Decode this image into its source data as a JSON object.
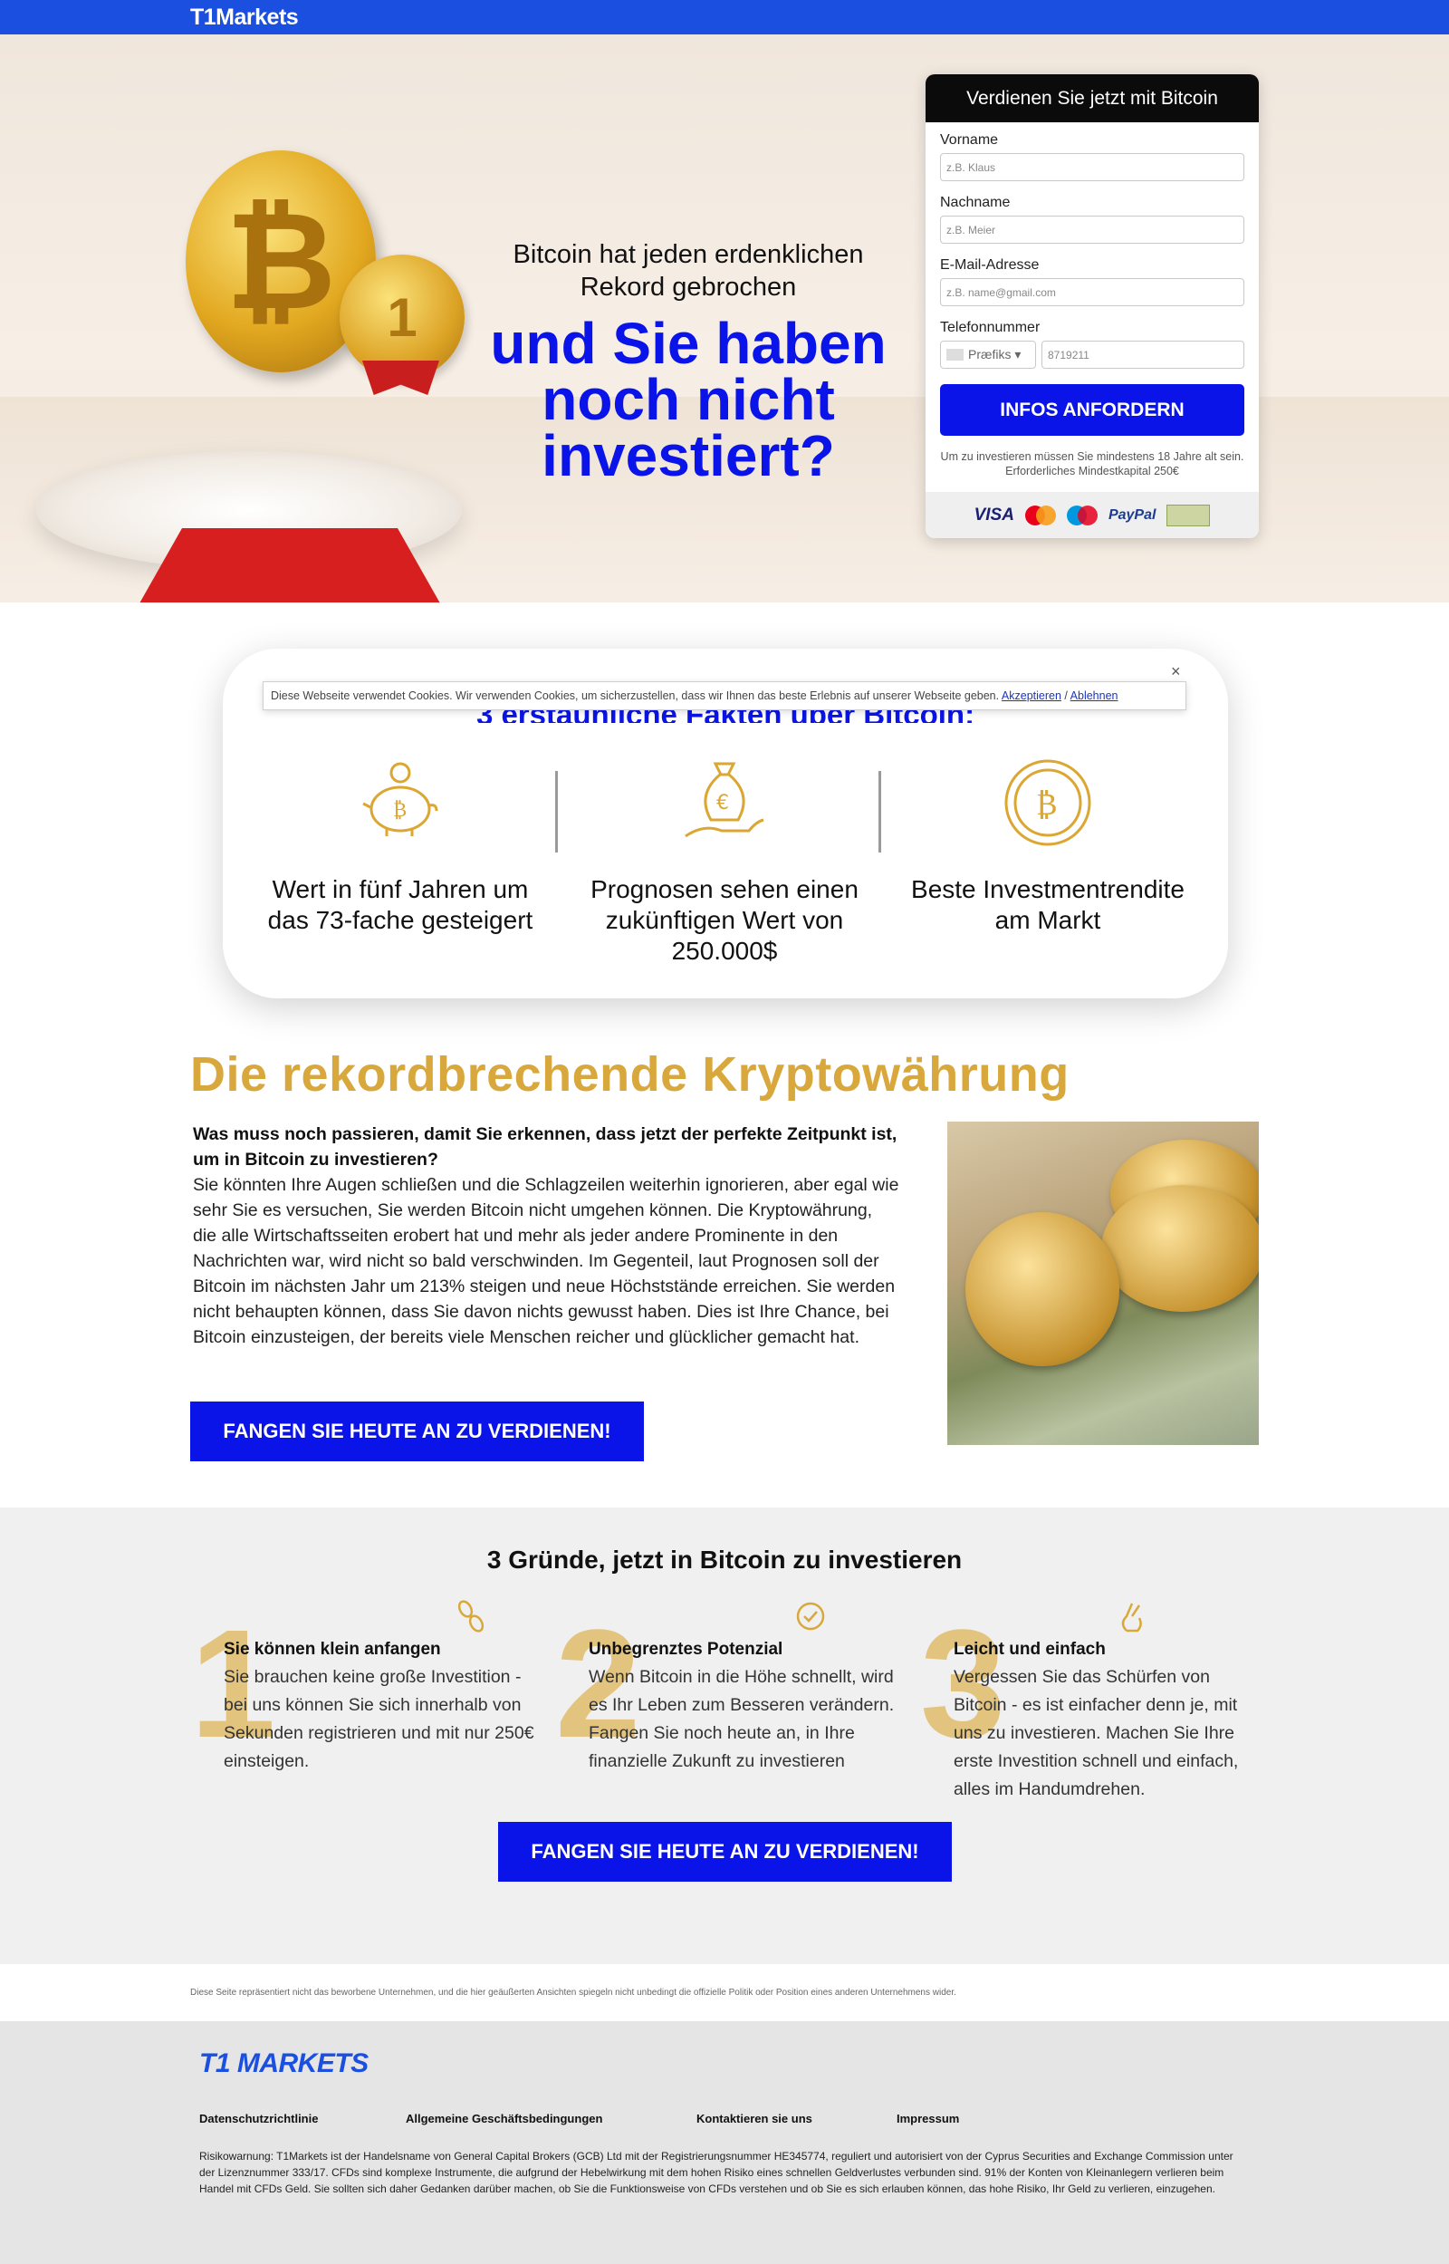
{
  "header": {
    "logo": "T1Markets"
  },
  "hero": {
    "subline": "Bitcoin hat jeden erdenklichen Rekord gebrochen",
    "headline": "und Sie haben noch nicht investiert?",
    "medal_number": "1"
  },
  "form": {
    "title": "Verdienen Sie jetzt mit Bitcoin",
    "first_name_label": "Vorname",
    "first_name_placeholder": "z.B. Klaus",
    "last_name_label": "Nachname",
    "last_name_placeholder": "z.B. Meier",
    "email_label": "E-Mail-Adresse",
    "email_placeholder": "z.B. name@gmail.com",
    "phone_label": "Telefonnummer",
    "prefix_label": "Præfiks ▾",
    "phone_placeholder": "8719211",
    "submit_label": "INFOS ANFORDERN",
    "disclaimer": "Um zu investieren müssen Sie mindestens 18 Jahre alt sein. Erforderliches Mindestkapital 250€",
    "payments": {
      "visa": "VISA",
      "paypal": "PayPal"
    }
  },
  "cookie": {
    "text": "Diese Webseite verwendet Cookies. Wir verwenden Cookies, um sicherzustellen, dass wir Ihnen das beste Erlebnis auf unserer Webseite geben. ",
    "accept": "Akzeptieren",
    "separator": " / ",
    "decline": "Ablehnen",
    "close": "×"
  },
  "facts": {
    "title": "3 erstaunliche Fakten über Bitcoin:",
    "items": [
      {
        "icon": "piggy-bank-bitcoin-icon",
        "text": "Wert in fünf Jahren um das 73-fache gesteigert"
      },
      {
        "icon": "money-bag-hand-icon",
        "text": "Prognosen sehen einen zukünftigen Wert von 250.000$"
      },
      {
        "icon": "bitcoin-coin-icon",
        "text": "Beste Investmentrendite am Markt"
      }
    ]
  },
  "record": {
    "title": "Die rekordbrechende Kryptowährung",
    "question": "Was muss noch passieren, damit Sie erkennen, dass jetzt der perfekte Zeitpunkt ist, um in Bitcoin zu investieren?",
    "body": "Sie könnten Ihre Augen schließen und die Schlagzeilen weiterhin ignorieren, aber egal wie sehr Sie es versuchen, Sie werden Bitcoin nicht umgehen können. Die Kryptowährung, die alle Wirtschaftsseiten erobert hat und mehr als jeder andere Prominente in den Nachrichten war, wird nicht so bald verschwinden. Im Gegenteil, laut Prognosen soll der Bitcoin im nächsten Jahr um 213% steigen und neue Höchststände erreichen. Sie werden nicht behaupten können, dass Sie davon nichts gewusst haben. Dies ist Ihre Chance, bei Bitcoin einzusteigen, der bereits viele Menschen reicher und glücklicher gemacht hat.",
    "cta": "FANGEN SIE HEUTE AN ZU VERDIENEN!"
  },
  "reasons": {
    "title": "3 Gründe, jetzt in Bitcoin zu investieren",
    "items": [
      {
        "num": "1",
        "icon": "coins-icon",
        "head": "Sie können klein anfangen",
        "text": "Sie brauchen keine große Investition - bei uns können Sie sich innerhalb von Sekunden registrieren und mit nur 250€ einsteigen."
      },
      {
        "num": "2",
        "icon": "badge-check-icon",
        "head": "Unbegrenztes Potenzial",
        "text": "Wenn Bitcoin in die Höhe schnellt, wird es Ihr Leben zum Besseren verändern. Fangen Sie noch heute an, in Ihre finanzielle Zukunft zu investieren"
      },
      {
        "num": "3",
        "icon": "fingers-crossed-icon",
        "head": "Leicht und einfach",
        "text": "Vergessen Sie das Schürfen von Bitcoin - es ist einfacher denn je, mit uns zu investieren. Machen Sie Ihre erste Investition schnell und einfach, alles im Handumdrehen."
      }
    ],
    "cta": "FANGEN SIE HEUTE AN ZU VERDIENEN!"
  },
  "note": "Diese Seite repräsentiert nicht das beworbene Unternehmen, und die hier geäußerten Ansichten spiegeln nicht unbedingt die offizielle Politik oder Position eines anderen Unternehmens wider.",
  "footer": {
    "logo": "T1 MARKETS",
    "links": [
      "Datenschutzrichtlinie",
      "Allgemeine Geschäftsbedingungen",
      "Kontaktieren sie uns",
      "Impressum"
    ],
    "risk": "Risikowarnung: T1Markets ist der Handelsname von General Capital Brokers (GCB) Ltd mit der Registrierungsnummer HE345774, reguliert und autorisiert von der Cyprus Securities and Exchange Commission unter der Lizenznummer 333/17. CFDs sind komplexe Instrumente, die aufgrund der Hebelwirkung mit dem hohen Risiko eines schnellen Geldverlustes verbunden sind. 91% der Konten von Kleinanlegern verlieren beim Handel mit CFDs Geld. Sie sollten sich daher Gedanken darüber machen, ob Sie die Funktionsweise von CFDs verstehen und ob Sie es sich erlauben können, das hohe Risiko, Ihr Geld zu verlieren, einzugehen."
  },
  "colors": {
    "brand_blue": "#1a4fe0",
    "cta_blue": "#0a14e8",
    "gold": "#d9a83c"
  }
}
